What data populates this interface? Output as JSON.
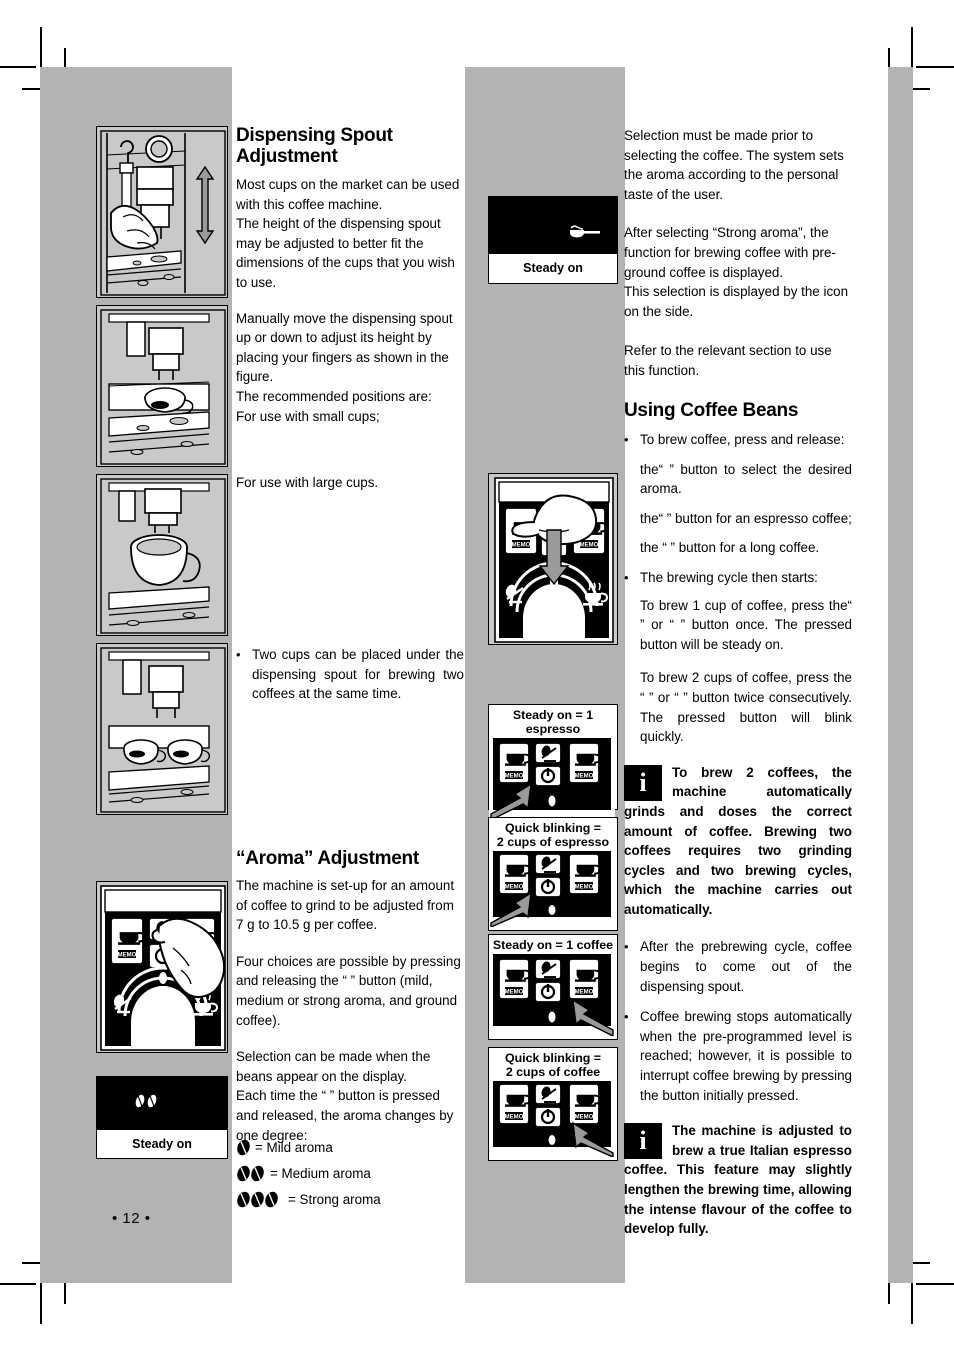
{
  "page": {
    "number": "• 12 •",
    "background_color": "#b3b3b3",
    "content_color": "#ffffff"
  },
  "left_column": {
    "heading_1_line1": "Dispensing Spout",
    "heading_1_line2": "Adjustment",
    "para_1": "Most cups on the market can be used with this coffee machine.\nThe height of the dispensing spout may be adjusted to better fit the dimensions of the cups that you wish to use.",
    "para_2": "Manually move the dispensing spout up or down to adjust its height by placing your fingers as shown in the figure.\nThe recommended positions are:\nFor use with small cups;",
    "para_3": "For use with large cups.",
    "bullet_1": "Two cups can be placed under the dispensing spout for brewing two coffees at the same time.",
    "heading_2": "“Aroma” Adjustment",
    "para_4": "The machine is set-up for an amount of coffee to grind to be adjusted from 7 g to 10.5 g per coffee.",
    "para_5": "Four choices are possible by pressing and releasing the “ ” button (mild, medium or strong aroma, and ground coffee).",
    "para_6": "Selection can be made when the beans appear on the display.\nEach time the “ ” button is pressed and released, the aroma changes by one degree:",
    "aroma_legend": [
      {
        "beans": 1,
        "label": "= Mild aroma"
      },
      {
        "beans": 2,
        "label": "= Medium aroma"
      },
      {
        "beans": 3,
        "label": "= Strong aroma"
      }
    ],
    "figures": [
      {
        "name": "spout-height-adjust-hand",
        "caption": ""
      },
      {
        "name": "spout-small-cup",
        "caption": ""
      },
      {
        "name": "spout-large-cup",
        "caption": ""
      },
      {
        "name": "spout-two-cups",
        "caption": ""
      },
      {
        "name": "control-panel-aroma-button-press",
        "caption": ""
      }
    ],
    "display_beans": {
      "label": "Steady on",
      "icon": "two-coffee-beans-icon"
    }
  },
  "center_column": {
    "display_preground": {
      "label": "Steady on",
      "icon": "pre-ground-coffee-scoop-icon"
    },
    "figure_brew_button_press": "control-panel-coffee-button-press",
    "captioned_panels": [
      {
        "caption_line1": "Steady on  = 1 espresso",
        "caption_line2": "",
        "figure": "control-panel-left-button-steady",
        "arrow": "left"
      },
      {
        "caption_line1": "Quick blinking =",
        "caption_line2": "2 cups of espresso",
        "figure": "control-panel-left-button-blinking",
        "arrow": "left"
      },
      {
        "caption_line1": "Steady on  = 1 coffee",
        "caption_line2": "",
        "figure": "control-panel-right-button-steady",
        "arrow": "right"
      },
      {
        "caption_line1": "Quick blinking =",
        "caption_line2": "2 cups of coffee",
        "figure": "control-panel-right-button-blinking",
        "arrow": "right"
      }
    ]
  },
  "right_column": {
    "para_1": "Selection must be made prior to selecting the coffee. The system sets the aroma according to the personal taste of the user.",
    "para_2": "After selecting “Strong aroma”, the function for brewing coffee with pre-ground coffee is displayed.\nThis selection is displayed by the icon on the side.",
    "para_3": "Refer to the relevant section to use this function.",
    "heading": "Using Coffee Beans",
    "bullet_1": "To brew coffee, press and release:",
    "sub_1": "the“ ” button to select the desired aroma.",
    "sub_2": "the“ ” button for an espresso coffee;",
    "sub_3": "the “ ” button for a long coffee.",
    "bullet_2": "The brewing cycle then starts:",
    "sub_4": "To brew 1 cup of coffee, press the“ ” or “ ” button once. The pressed button will be steady on.",
    "sub_5": "To brew 2 cups of coffee, press the “ ” or “ ” button twice consecutively. The pressed button will blink quickly.",
    "info_1": "To brew 2 coffees, the machine automatically grinds and doses the correct amount of coffee. Brewing two coffees requires two grinding cycles and two brewing cycles, which the machine carries out automatically.",
    "bullet_3": "After the prebrewing cycle, coffee begins to come out of the dispensing spout.",
    "bullet_4": "Coffee brewing stops automatically when the pre-programmed level is reached; however, it is possible to interrupt coffee brewing by pressing the button initially pressed.",
    "info_2": "The machine is adjusted to brew a true Italian espresso coffee. This feature may slightly lengthen the brewing time, allowing the intense flavour of the coffee to develop fully.",
    "info_icon": "i"
  }
}
